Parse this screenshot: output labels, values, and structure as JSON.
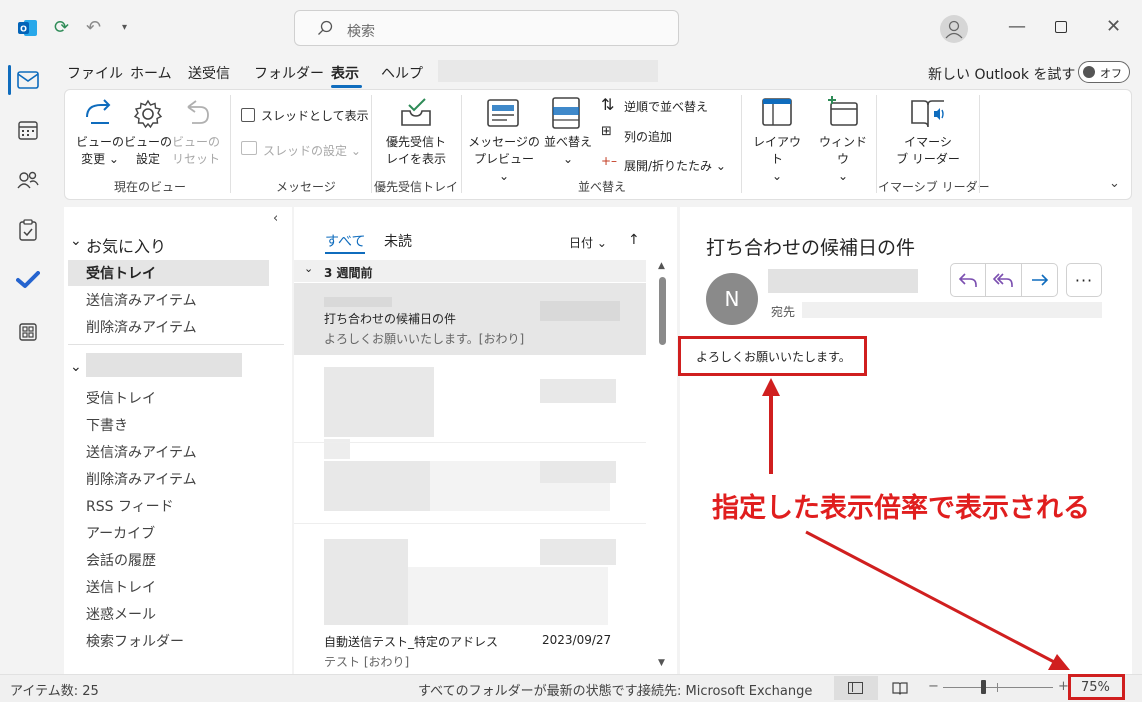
{
  "search": {
    "placeholder": "検索"
  },
  "tabs": [
    "ファイル",
    "ホーム",
    "送受信",
    "フォルダー",
    "表示",
    "ヘルプ"
  ],
  "new_outlook": {
    "label": "新しい Outlook を試す",
    "toggle": "オフ"
  },
  "ribbon": {
    "view_change": [
      "ビューの",
      "変更 ⌄"
    ],
    "view_settings": [
      "ビューの",
      "設定"
    ],
    "view_reset": [
      "ビューの",
      "リセット"
    ],
    "group_current_view": "現在のビュー",
    "thread_view": "スレッドとして表示",
    "thread_settings": "スレッドの設定 ⌄",
    "group_message": "メッセージ",
    "focused_inbox": [
      "優先受信ト",
      "レイを表示"
    ],
    "group_focused": "優先受信トレイ",
    "message_preview": [
      "メッセージの",
      "プレビュー ⌄"
    ],
    "arrange": [
      "並べ替え",
      "⌄"
    ],
    "reverse_sort": "逆順で並べ替え",
    "add_column": "列の追加",
    "expand_collapse": "展開/折りたたみ ⌄",
    "group_arrange": "並べ替え",
    "layout": [
      "レイアウト",
      "⌄"
    ],
    "window": [
      "ウィンドウ",
      "⌄"
    ],
    "immersive_reader": [
      "イマーシ",
      "ブ リーダー"
    ],
    "group_immersive": "イマーシブ リーダー"
  },
  "folders": {
    "favorites_header": "お気に入り",
    "favorites": [
      "受信トレイ",
      "送信済みアイテム",
      "削除済みアイテム"
    ],
    "account": [
      "受信トレイ",
      "下書き",
      "送信済みアイテム",
      "削除済みアイテム",
      "RSS フィード",
      "アーカイブ",
      "会話の履歴",
      "送信トレイ",
      "迷惑メール",
      "検索フォルダー"
    ]
  },
  "message_list": {
    "tab_all": "すべて",
    "tab_unread": "未読",
    "sort": "日付 ⌄",
    "sort_dir": "↑",
    "group_header": "3 週間前",
    "selected_subject": "打ち合わせの候補日の件",
    "selected_preview": "よろしくお願いいたします。[おわり]",
    "last_subject": "自動送信テスト_特定のアドレス",
    "last_date": "2023/09/27",
    "last_preview": "テスト [おわり]"
  },
  "reading": {
    "subject": "打ち合わせの候補日の件",
    "avatar": "N",
    "to_label": "宛先",
    "body": "よろしくお願いいたします。",
    "callout": "指定した表示倍率で表示される"
  },
  "status": {
    "items": "アイテム数: 25",
    "sync": "すべてのフォルダーが最新の状態です。",
    "connection": "接続先: Microsoft Exchange",
    "zoom_minus": "−",
    "zoom_plus": "+",
    "zoom": "75%"
  },
  "colors": {
    "accent": "#0f6cbd",
    "callout": "#d01f1f"
  }
}
